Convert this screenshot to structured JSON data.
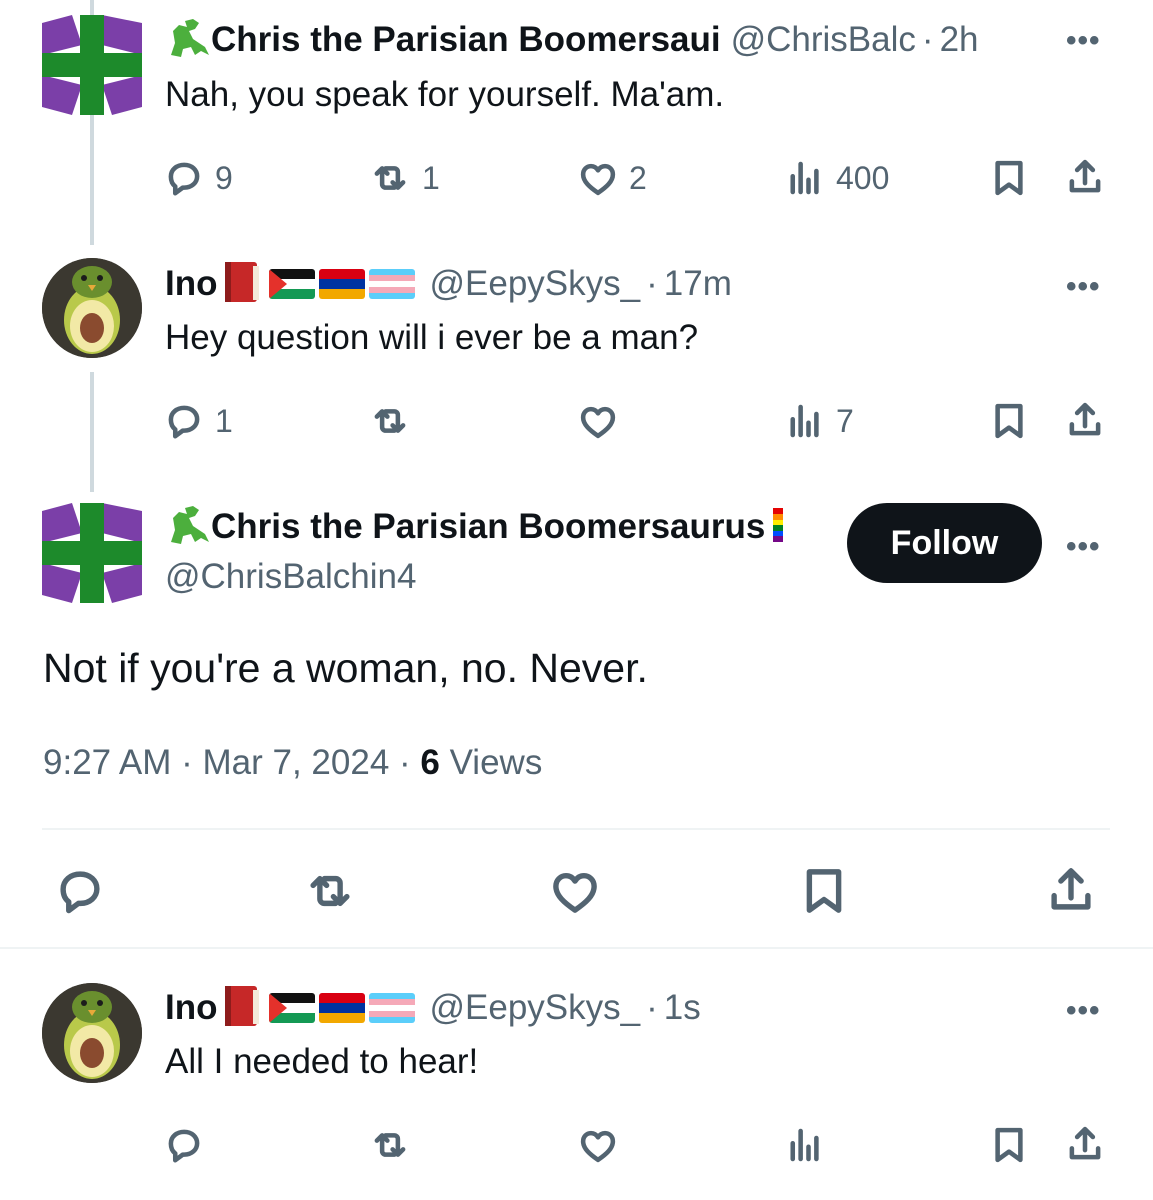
{
  "tweets": [
    {
      "display_name": "Chris the Parisian Boomersaui",
      "handle": "@ChrisBalc",
      "sep": "·",
      "time": "2h",
      "text": "Nah, you speak for yourself. Ma'am.",
      "replies": "9",
      "retweets": "1",
      "likes": "2",
      "views": "400"
    },
    {
      "display_name": "Ino",
      "handle": "@EepySkys_",
      "sep": "·",
      "time": "17m",
      "text": "Hey question will i ever be a man?",
      "replies": "1",
      "retweets": "",
      "likes": "",
      "views": "7"
    }
  ],
  "main_tweet": {
    "display_name": "Chris the Parisian Boomersaurus",
    "handle": "@ChrisBalchin4",
    "follow_label": "Follow",
    "text": "Not if you're a woman, no. Never.",
    "timestamp": "9:27 AM · Mar 7, 2024 · ",
    "views_count": "6",
    "views_label": " Views"
  },
  "reply": {
    "display_name": "Ino",
    "handle": "@EepySkys_",
    "sep": "·",
    "time": "1s",
    "text": "All I needed to hear!"
  },
  "more_label": "•••",
  "colors": {
    "text": "#0f1419",
    "secondary": "#536471",
    "follow_bg": "#0f1419",
    "divider": "#eff3f4",
    "thread_line": "#cfd9de",
    "flag_green": "#1d8a2b",
    "flag_purple": "#7b3fa8"
  },
  "icons": [
    "reply-icon",
    "retweet-icon",
    "like-icon",
    "views-icon",
    "bookmark-icon",
    "share-icon",
    "dinosaur-icon",
    "book-icon",
    "palestine-flag-icon",
    "armenia-flag-icon",
    "trans-flag-icon",
    "pride-flag-icon"
  ]
}
